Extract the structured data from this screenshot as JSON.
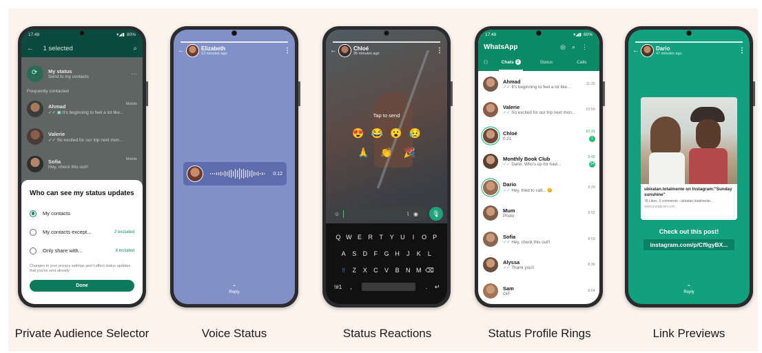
{
  "captions": [
    "Private Audience Selector",
    "Voice Status",
    "Status Reactions",
    "Status Profile Rings",
    "Link Previews"
  ],
  "phone1": {
    "time": "17:48",
    "battery": "80%",
    "title": "1 selected",
    "my_status": {
      "name": "My status",
      "sub": "Send to my contacts"
    },
    "section": "Frequently contacted",
    "contacts": [
      {
        "name": "Ahmad",
        "sub": "It's beginning to feel a lot like...",
        "tag": "Mobile"
      },
      {
        "name": "Valerie",
        "sub": "So excited for our trip next mon...",
        "tag": ""
      },
      {
        "name": "Sofia",
        "sub": "Hey, check this out!!",
        "tag": "Mobile"
      }
    ],
    "sheet": {
      "title": "Who can see my status updates",
      "options": [
        {
          "label": "My contacts",
          "meta": ""
        },
        {
          "label": "My contacts except...",
          "meta": "2 excluded"
        },
        {
          "label": "Only share with...",
          "meta": "8 included"
        }
      ],
      "note": "Changes to your privacy settings won't affect status updates that you've sent already",
      "done": "Done"
    }
  },
  "phone2": {
    "name": "Elizabeth",
    "time": "12 minutes ago",
    "duration": "0:12",
    "reply": "Reply"
  },
  "phone3": {
    "name": "Chloé",
    "time": "35 minutes ago",
    "tap_to_send": "Tap to send",
    "emojis_row1": [
      "😍",
      "😂",
      "😮",
      "😥"
    ],
    "emojis_row2": [
      "🙏",
      "👏",
      "🎉"
    ],
    "keyboard": {
      "row1": [
        "Q",
        "W",
        "E",
        "R",
        "T",
        "Y",
        "U",
        "I",
        "O",
        "P"
      ],
      "row2": [
        "A",
        "S",
        "D",
        "F",
        "G",
        "H",
        "J",
        "K",
        "L"
      ],
      "row3": [
        "⇧",
        "Z",
        "X",
        "C",
        "V",
        "B",
        "N",
        "M",
        "⌫"
      ],
      "row4_left": "!#1",
      "row4_comma": ",",
      "row4_dot": ".",
      "row4_enter": "↵"
    }
  },
  "phone4": {
    "time": "17:48",
    "battery": "80%",
    "app": "WhatsApp",
    "tabs": [
      "Chats",
      "Status",
      "Calls"
    ],
    "chats_badge": "2",
    "chats": [
      {
        "name": "Ahmad",
        "sub": "It's beginning to feel a lot like...",
        "time": "11:26",
        "unread": "",
        "ring": false,
        "green": false
      },
      {
        "name": "Valerie",
        "sub": "So excited for our trip next mon...",
        "time": "10:55",
        "unread": "",
        "ring": false,
        "green": false
      },
      {
        "name": "Chloé",
        "sub": "0:21",
        "time": "10:31",
        "unread": "1",
        "ring": true,
        "green": true
      },
      {
        "name": "Monthly Book Club",
        "sub": "Dario: Who's up for havi...",
        "time": "9:42",
        "unread": "14",
        "ring": false,
        "green": true
      },
      {
        "name": "Dario",
        "sub": "Hey, tried to call... 😊",
        "time": "9:29",
        "unread": "",
        "ring": true,
        "green": false
      },
      {
        "name": "Mum",
        "sub": "Photo",
        "time": "9:02",
        "unread": "",
        "ring": false,
        "green": false
      },
      {
        "name": "Sofia",
        "sub": "Hey, check this out!!",
        "time": "8:59",
        "unread": "",
        "ring": false,
        "green": false
      },
      {
        "name": "Alyssa",
        "sub": "Thank you!!",
        "time": "8:36",
        "unread": "",
        "ring": false,
        "green": false
      },
      {
        "name": "Sam",
        "sub": "GIF",
        "time": "8:04",
        "unread": "",
        "ring": false,
        "green": false
      }
    ]
  },
  "phone5": {
    "name": "Dario",
    "time": "47 minutes ago",
    "card_title": "ubiratan.totalmente on Instagram:\"Sunday sunshine\"",
    "card_meta": "78 Likes, 9 comments - ubiratan.totalmente...",
    "card_url": "www.instagram.com",
    "text": "Check out this post!",
    "link": "instagram.com/p/Cf9gyBX...",
    "reply": "Reply"
  },
  "colors": {
    "brand_green": "#0b8a66",
    "status_ring": "#1fbf7a",
    "voice_bg": "#8190c7",
    "link_bg": "#12a17e"
  }
}
